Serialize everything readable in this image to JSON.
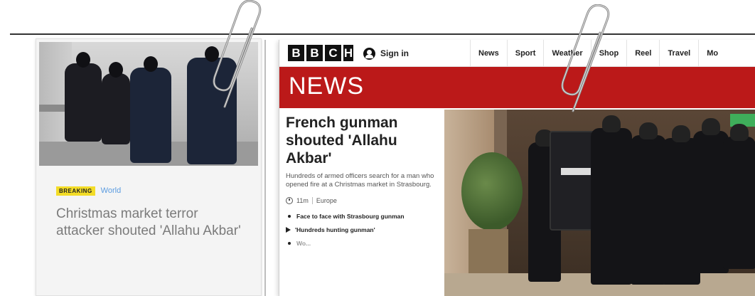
{
  "left_card": {
    "badge": "BREAKING",
    "category": "World",
    "headline": "Christmas market terror attacker shouted 'Allahu Akbar'"
  },
  "bbc": {
    "logo_letters": [
      "B",
      "B",
      "C",
      "H"
    ],
    "signin_label": "Sign in",
    "nav_items": [
      "News",
      "Sport",
      "Weather",
      "Shop",
      "Reel",
      "Travel",
      "Mo"
    ],
    "banner_title": "NEWS",
    "story": {
      "headline": "French gunman shouted 'Allahu Akbar'",
      "summary": "Hundreds of armed officers search for a man who opened fire at a Christmas market in Strasbourg.",
      "time": "11m",
      "section": "Europe",
      "related": [
        {
          "type": "bullet",
          "text": "Face to face with Strasbourg gunman"
        },
        {
          "type": "video",
          "text": "'Hundreds hunting gunman'"
        },
        {
          "type": "bullet",
          "text": "Wo..."
        }
      ]
    }
  },
  "colors": {
    "bbc_red": "#bb1919",
    "breaking_yellow": "#f3dc27",
    "world_blue": "#5a9be0"
  }
}
